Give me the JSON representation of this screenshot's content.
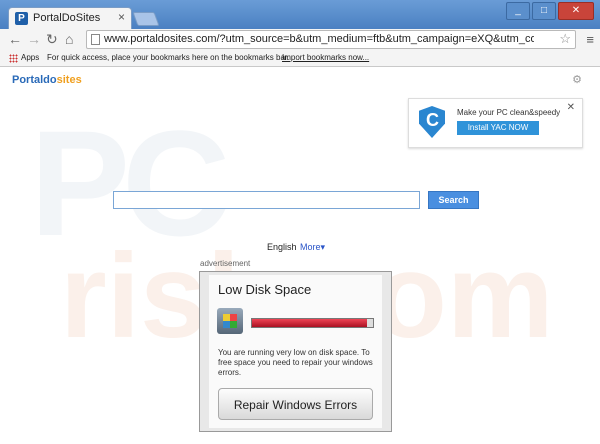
{
  "browser": {
    "tab_title": "PortalDoSites",
    "tab_favicon": "P",
    "url": "www.portaldosites.com/?utm_source=b&utm_medium=ftb&utm_campaign=eXQ&utm_content=sc&f",
    "window_buttons": [
      "_",
      "□",
      "✕"
    ]
  },
  "bookmarks_bar": {
    "apps_label": "Apps",
    "hint": "For quick access, place your bookmarks here on the bookmarks bar.",
    "import_link": "Import bookmarks now..."
  },
  "page": {
    "logo_main": "Portaldo",
    "logo_accent": "sites",
    "watermark": "PC",
    "watermark2": "risk.com",
    "promo": {
      "text": "Make your PC clean&speedy",
      "button": "Install YAC NOW",
      "shield_letter": "C",
      "close": "✕"
    },
    "search": {
      "value": "",
      "button": "Search"
    },
    "language": "English",
    "more": "More▾",
    "ad_label": "advertisement",
    "ad": {
      "title": "Low Disk Space",
      "disk_usage_fraction": 0.95,
      "message": "You are running very low on disk space. To free space you need to repair your windows errors.",
      "button": "Repair Windows Errors"
    }
  },
  "icons": [
    "back-arrow-icon",
    "forward-arrow-icon",
    "reload-icon",
    "home-icon",
    "page-icon",
    "star-icon",
    "menu-icon",
    "apps-icon",
    "gear-icon",
    "shield-icon",
    "close-icon",
    "disk-icon"
  ],
  "colors": {
    "accent": "#2f93d9",
    "chrome_frame": "#4a80c2",
    "search_button": "#4a8fe0"
  }
}
